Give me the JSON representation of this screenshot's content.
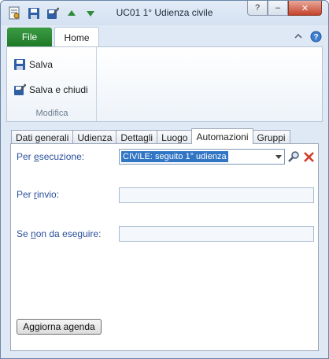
{
  "window": {
    "title": "UC01 1° Udienza civile"
  },
  "qat": {
    "icons": [
      "app-icon",
      "save-icon",
      "save-close-icon",
      "up-arrow-icon",
      "down-arrow-icon"
    ]
  },
  "window_controls": {
    "help": "?",
    "minimize": "–",
    "close": "✕"
  },
  "ribbon": {
    "tabs": [
      {
        "label": "File"
      },
      {
        "label": "Home"
      }
    ],
    "group": {
      "label": "Modifica",
      "buttons": [
        {
          "label": "Salva"
        },
        {
          "label": "Salva e chiudi"
        }
      ]
    }
  },
  "form": {
    "tabs": [
      {
        "label": "Dati generali"
      },
      {
        "label": "Udienza"
      },
      {
        "label": "Dettagli"
      },
      {
        "label": "Luogo"
      },
      {
        "label": "Automazioni"
      },
      {
        "label": "Gruppi"
      }
    ],
    "active_tab": "Automazioni",
    "fields": {
      "per_esecuzione": {
        "label_pre": "Per ",
        "label_u": "e",
        "label_post": "secuzione:",
        "value": "CIVILE: seguito 1° udienza"
      },
      "per_rinvio": {
        "label_pre": "Per ",
        "label_u": "r",
        "label_post": "invio:",
        "value": ""
      },
      "se_non_da_eseguire": {
        "label_pre": "Se ",
        "label_u": "n",
        "label_post": "on da eseguire:",
        "value": ""
      }
    },
    "button": {
      "label": "Aggiorna agenda"
    }
  },
  "colors": {
    "file_tab": "#2a8a33",
    "label_blue": "#2a4f9c",
    "selection": "#3175c5",
    "close_red": "#c4432c"
  }
}
